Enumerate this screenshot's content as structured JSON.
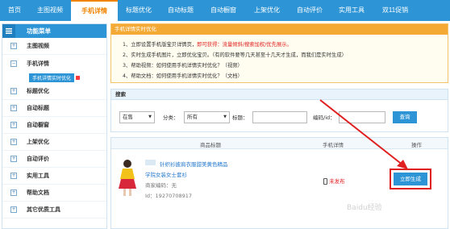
{
  "topnav": {
    "items": [
      {
        "label": "首页"
      },
      {
        "label": "主图视频"
      },
      {
        "label": "手机详情"
      },
      {
        "label": "标题优化"
      },
      {
        "label": "自动标题"
      },
      {
        "label": "自动橱窗"
      },
      {
        "label": "上架优化"
      },
      {
        "label": "自动评价"
      },
      {
        "label": "实用工具"
      },
      {
        "label": "双11促销"
      }
    ]
  },
  "sidebar": {
    "header": "功能菜单",
    "items": [
      {
        "label": "主图视频"
      },
      {
        "label": "手机详情"
      },
      {
        "label": "标题优化"
      },
      {
        "label": "自动标题"
      },
      {
        "label": "自动橱窗"
      },
      {
        "label": "上架优化"
      },
      {
        "label": "自动评价"
      },
      {
        "label": "实用工具"
      },
      {
        "label": "帮助文档"
      },
      {
        "label": "其它优质工具"
      }
    ],
    "sub_item": "手机详情实时优化"
  },
  "notice": {
    "title": "手机详情实时优化",
    "line1_a": "1、立即设置手机版宝贝详情页，",
    "line1_b": "即可获得：流量倾斜/搜索加权/优先展示。",
    "line2": "2、实时生成手机图片，立即优化宝贝。（有的软件要等几天甚至十几天才生成，而我们是实时生成）",
    "line3": "3、帮助视频：如何使用手机详情实时优化？（视频）",
    "line4": "4、帮助文档：如何使用手机详情实时优化？（文档）"
  },
  "search": {
    "title": "搜索",
    "status_value": "在售",
    "category_label": "分类：",
    "category_value": "所有",
    "title_label": "标题：",
    "title_value": "",
    "code_label": "编码/id：",
    "code_value": "",
    "query_button": "查询"
  },
  "table": {
    "headers": {
      "product": "商品标题",
      "mobile": "手机详情",
      "action": "操作"
    },
    "row": {
      "title": "针织衫披肩衣服甜美黄色精品",
      "subtitle": "学院女装女士套衫",
      "merchant_code": "商家编码：无",
      "id": "Id：19270708917",
      "mobile_status": "未发布",
      "action_button": "立即生成"
    }
  },
  "watermark": "Baidu经验",
  "colors": {
    "accent": "#2d95d6",
    "active": "#f08300",
    "highlight": "#e02020"
  }
}
